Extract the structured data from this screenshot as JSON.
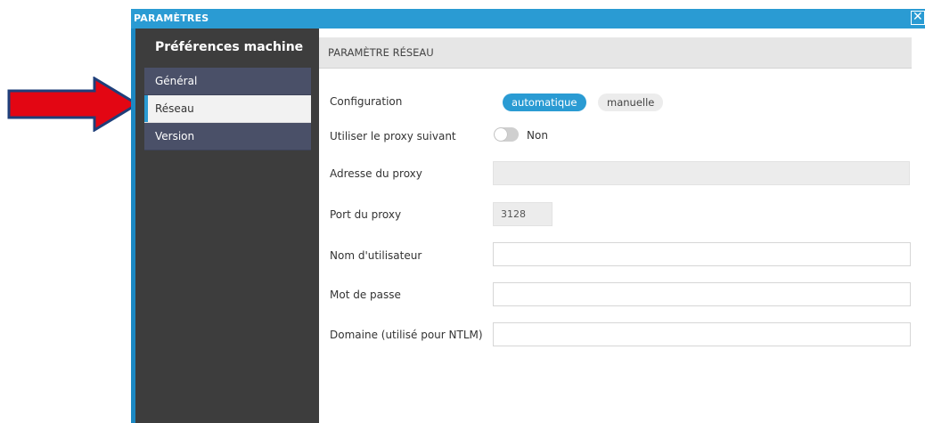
{
  "window": {
    "title": "PARAMÈTRES",
    "close_glyph": "✕",
    "close_icon": "close-icon",
    "accent_color": "#2a9bd3"
  },
  "sidebar": {
    "title": "Préférences machine",
    "items": [
      {
        "label": "Général",
        "active": false
      },
      {
        "label": "Réseau",
        "active": true
      },
      {
        "label": "Version",
        "active": false
      }
    ]
  },
  "annotation": {
    "arrow_icon": "red-arrow-icon",
    "arrow_color": "#e30613"
  },
  "section": {
    "title": "PARAMÈTRE RÉSEAU"
  },
  "form": {
    "configuration": {
      "label": "Configuration",
      "options": [
        "automatique",
        "manuelle"
      ],
      "selected": "automatique"
    },
    "use_proxy": {
      "label": "Utiliser le proxy suivant",
      "toggle_text": "Non",
      "enabled": false
    },
    "proxy_address": {
      "label": "Adresse du proxy",
      "value": ""
    },
    "proxy_port": {
      "label": "Port du proxy",
      "value": "3128"
    },
    "username": {
      "label": "Nom d'utilisateur",
      "value": ""
    },
    "password": {
      "label": "Mot de passe",
      "value": ""
    },
    "domain": {
      "label": "Domaine (utilisé pour NTLM)",
      "value": ""
    }
  }
}
